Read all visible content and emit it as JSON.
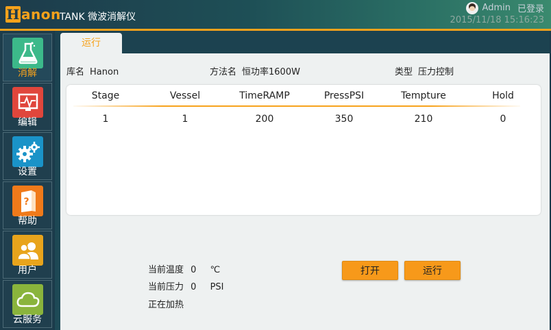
{
  "brand": {
    "logo_mark": "H",
    "logo_text": "anon"
  },
  "app_title": "TANK 微波消解仪",
  "user": {
    "name": "Admin",
    "login_state": "已登录"
  },
  "datetime": "2015/11/18 15:16:23",
  "colors": {
    "accent": "#f7a21b",
    "header_bg": "#1d3b4b",
    "panel_bg": "#eef1f1"
  },
  "sidebar": {
    "items": [
      {
        "label": "消解",
        "icon": "flask-icon",
        "color": "#3cb98a",
        "active": true
      },
      {
        "label": "编辑",
        "icon": "chart-monitor-icon",
        "color": "#e0463c",
        "active": false
      },
      {
        "label": "设置",
        "icon": "gears-icon",
        "color": "#1a93c8",
        "active": false
      },
      {
        "label": "帮助",
        "icon": "help-book-icon",
        "color": "#f07a1a",
        "active": false
      },
      {
        "label": "用户",
        "icon": "users-icon",
        "color": "#e8a41c",
        "active": false
      },
      {
        "label": "云服务",
        "icon": "cloud-icon",
        "color": "#8ab43c",
        "active": false
      }
    ]
  },
  "tab": {
    "label": "运行"
  },
  "info": {
    "library_label": "库名",
    "library_value": "Hanon",
    "method_label": "方法名",
    "method_value": "恒功率1600W",
    "type_label": "类型",
    "type_value": "压力控制"
  },
  "table": {
    "headers": [
      "Stage",
      "Vessel",
      "TimeRAMP",
      "PressPSI",
      "Tempture",
      "Hold"
    ],
    "rows": [
      [
        "1",
        "1",
        "200",
        "350",
        "210",
        "0"
      ]
    ]
  },
  "status": {
    "temp_label": "当前温度",
    "temp_value": "0",
    "temp_unit": "℃",
    "press_label": "当前压力",
    "press_value": "0",
    "press_unit": "PSI",
    "state_text": "正在加热"
  },
  "buttons": {
    "open_label": "打开",
    "run_label": "运行"
  }
}
